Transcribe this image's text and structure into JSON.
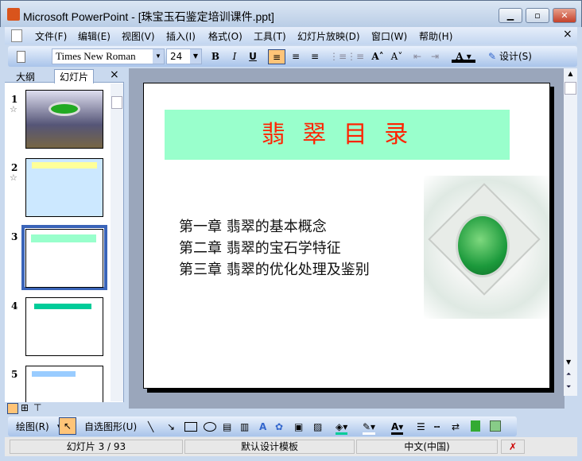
{
  "window": {
    "title": "Microsoft PowerPoint - [珠宝玉石鉴定培训课件.ppt]",
    "minimize": "▁",
    "maximize": "▫",
    "close": "✕"
  },
  "menu": {
    "items": [
      "文件(F)",
      "编辑(E)",
      "视图(V)",
      "插入(I)",
      "格式(O)",
      "工具(T)",
      "幻灯片放映(D)",
      "窗口(W)",
      "帮助(H)"
    ],
    "close": "×"
  },
  "toolbar": {
    "font": "Times New Roman",
    "size": "24",
    "bold": "B",
    "italic": "I",
    "underline": "U",
    "design": "设计(S)"
  },
  "leftpane": {
    "tabs": [
      "大纲",
      "幻灯片"
    ],
    "close": "×",
    "slides": [
      "1",
      "2",
      "3",
      "4",
      "5"
    ]
  },
  "slide": {
    "title": "翡 翠 目 录",
    "lines": [
      "第一章  翡翠的基本概念",
      "第二章  翡翠的宝石学特征",
      "第三章  翡翠的优化处理及鉴别"
    ]
  },
  "drawbar": {
    "draw": "绘图(R)",
    "autoshapes": "自选图形(U)"
  },
  "status": {
    "slide": "幻灯片 3 / 93",
    "template": "默认设计模板",
    "lang": "中文(中国)"
  },
  "colors": {
    "title_bg": "#99ffcc",
    "title_text": "#ff2200",
    "selection": "#3a64b8"
  }
}
